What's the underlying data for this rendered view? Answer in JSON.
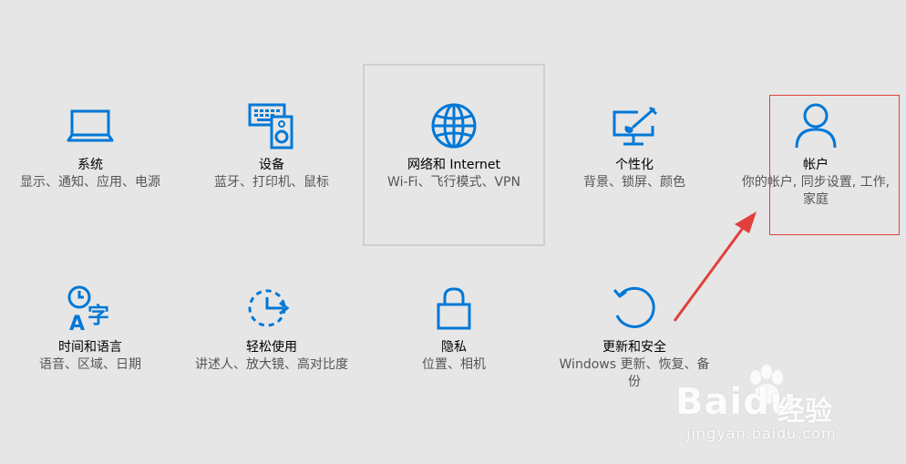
{
  "colors": {
    "accent": "#0078d7",
    "background": "#e6e6e6",
    "annotation_red": "#e0403c"
  },
  "tiles": [
    {
      "icon": "laptop-icon",
      "title": "系统",
      "desc": "显示、通知、应用、电源"
    },
    {
      "icon": "keyboard-speaker-icon",
      "title": "设备",
      "desc": "蓝牙、打印机、鼠标"
    },
    {
      "icon": "globe-icon",
      "title": "网络和 Internet",
      "desc": "Wi-Fi、飞行模式、VPN"
    },
    {
      "icon": "paint-brush-monitor-icon",
      "title": "个性化",
      "desc": "背景、锁屏、颜色"
    },
    {
      "icon": "person-icon",
      "title": "帐户",
      "desc": "你的帐户, 同步设置, 工作, 家庭"
    },
    {
      "icon": "clock-language-icon",
      "title": "时间和语言",
      "desc": "语音、区域、日期"
    },
    {
      "icon": "ease-of-access-icon",
      "title": "轻松使用",
      "desc": "讲述人、放大镜、高对比度"
    },
    {
      "icon": "lock-icon",
      "title": "隐私",
      "desc": "位置、相机"
    },
    {
      "icon": "refresh-icon",
      "title": "更新和安全",
      "desc": "Windows 更新、恢复、备份"
    }
  ],
  "watermark": {
    "brand": "Bai",
    "brand_suffix": "du",
    "brand_cn": "经验",
    "url": "jingyan.baidu.com"
  }
}
